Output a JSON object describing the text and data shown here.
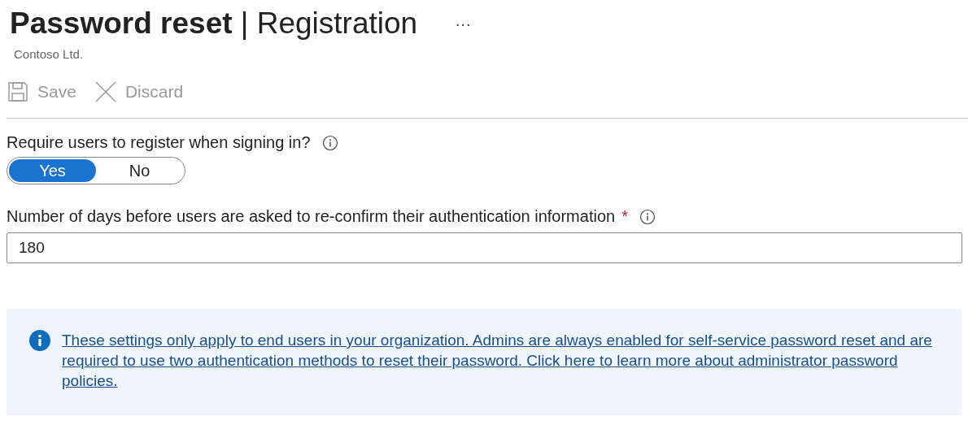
{
  "header": {
    "title": "**Password reset** | Registration",
    "more": "···",
    "subtitle": "Contoso Ltd."
  },
  "toolbar": [
    {
      "kind": "save",
      "label": "Save",
      "disabled": true
    },
    {
      "kind": "discard",
      "label": "Discard",
      "disabled": true
    }
  ],
  "register_setting": {
    "label": "Require users to register when signing in?",
    "options": [
      {
        "label": "Yes",
        "selected": true
      },
      {
        "label": "No",
        "selected": false
      }
    ]
  },
  "days_setting": {
    "label": "Number of days before users are asked to re-confirm their authentication information",
    "required_mark": "*",
    "value": "180"
  },
  "info_banner": {
    "link": "These settings only apply to end users in your organization. Admins are always enabled for self-service password reset and are required to use two authentication methods to reset their password. Click here to learn more about administrator password policies."
  }
}
